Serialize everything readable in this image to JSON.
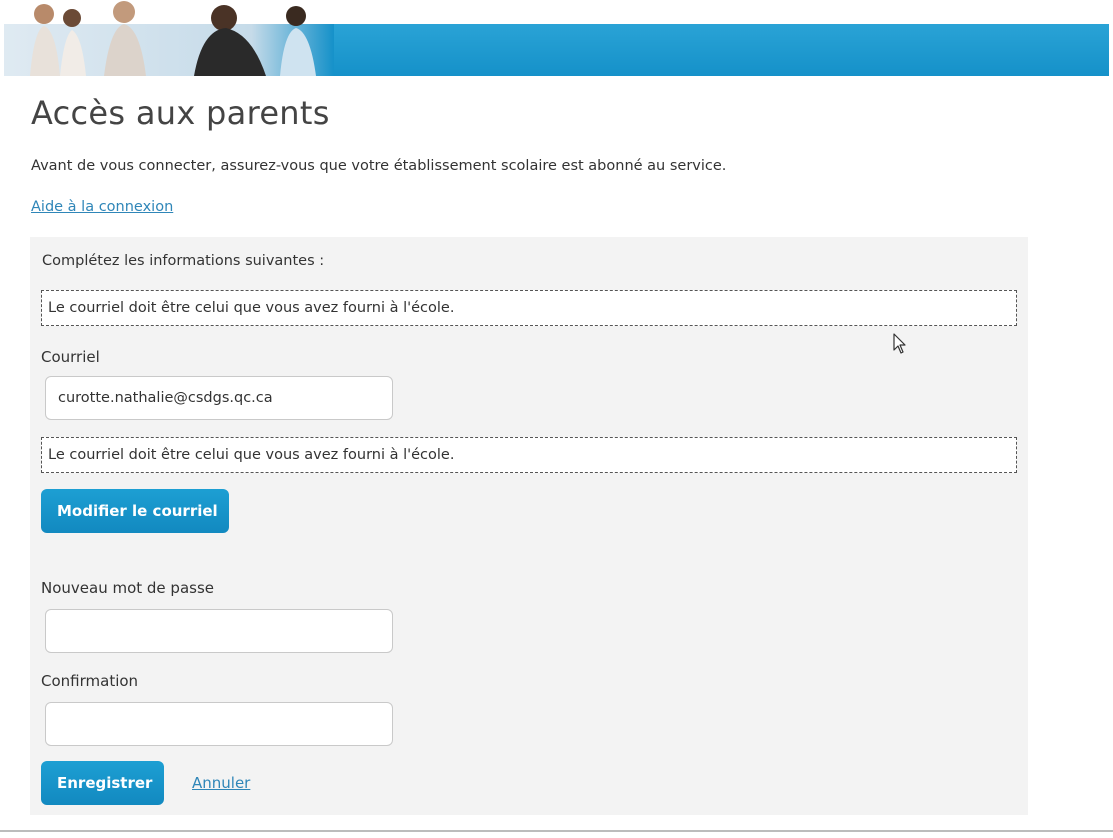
{
  "colors": {
    "brand_blue": "#1591c9",
    "button_blue": "#1289c0",
    "link_blue": "#2f86b8",
    "panel_background": "#f3f3f3"
  },
  "header": {
    "banner_icon": "family-photo-banner"
  },
  "page": {
    "title": "Accès aux parents",
    "intro": "Avant de vous connecter, assurez-vous que votre établissement scolaire est abonné au service.",
    "help_link": "Aide à la connexion"
  },
  "form": {
    "instructions": "Complétez les informations suivantes :",
    "notice_top": "Le courriel doit être celui que vous avez fourni à l'école.",
    "email_label": "Courriel",
    "email_value": "curotte.nathalie@csdgs.qc.ca",
    "notice_email": "Le courriel doit être celui que vous avez fourni à l'école.",
    "modify_email_button": "Modifier le courriel",
    "new_password_label": "Nouveau mot de passe",
    "new_password_value": "",
    "confirm_label": "Confirmation",
    "confirm_value": "",
    "save_button": "Enregistrer",
    "cancel_link": "Annuler"
  }
}
